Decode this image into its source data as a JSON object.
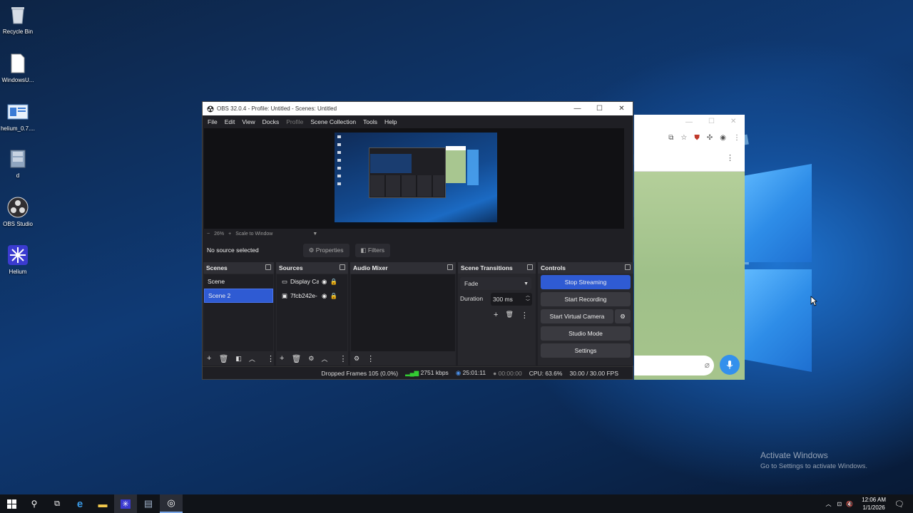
{
  "desktop": {
    "icons": [
      {
        "label": "Recycle Bin",
        "icon": "recycle-bin-icon"
      },
      {
        "label": "WindowsU...",
        "icon": "document-icon"
      },
      {
        "label": "helium_0.7....",
        "icon": "installer-icon"
      },
      {
        "label": "d",
        "icon": "archive-icon"
      },
      {
        "label": "OBS Studio",
        "icon": "obs-icon"
      },
      {
        "label": "Helium",
        "icon": "helium-icon"
      }
    ],
    "activate_title": "Activate Windows",
    "activate_sub": "Go to Settings to activate Windows."
  },
  "obs": {
    "title": "OBS 32.0.4 - Profile: Untitled - Scenes: Untitled",
    "menu": [
      "File",
      "Edit",
      "View",
      "Docks",
      "Profile",
      "Scene Collection",
      "Tools",
      "Help"
    ],
    "zoom": {
      "minus": "−",
      "value": "26%",
      "plus": "+",
      "mode": "Scale to Window"
    },
    "no_source": "No source selected",
    "properties": "Properties",
    "filters": "Filters",
    "docks": {
      "scenes": {
        "title": "Scenes",
        "items": [
          "Scene",
          "Scene 2"
        ],
        "selected": "Scene 2"
      },
      "sources": {
        "title": "Sources",
        "items": [
          "Display Ca",
          "7fcb242e-"
        ]
      },
      "mixer": {
        "title": "Audio Mixer"
      },
      "transitions": {
        "title": "Scene Transitions",
        "type": "Fade",
        "duration_label": "Duration",
        "duration": "300 ms"
      },
      "controls": {
        "title": "Controls",
        "stop_streaming": "Stop Streaming",
        "start_recording": "Start Recording",
        "start_virtual_camera": "Start Virtual Camera",
        "studio_mode": "Studio Mode",
        "settings": "Settings"
      }
    },
    "status": {
      "dropped": "Dropped Frames 105 (0.0%)",
      "bitrate": "2751 kbps",
      "stream_time": "25:01:11",
      "rec_time": "00:00:00",
      "cpu": "CPU: 63.6%",
      "fps": "30.00 / 30.00 FPS"
    }
  },
  "taskbar": {
    "time": "12:06 AM",
    "date": "1/1/2026"
  },
  "colors": {
    "accent": "#2f5bd3",
    "telegram_blue": "#3390ec"
  }
}
